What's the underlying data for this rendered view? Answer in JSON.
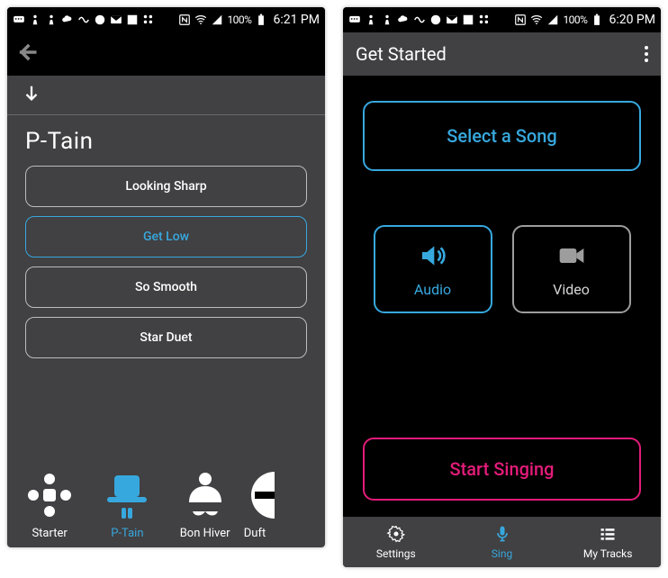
{
  "status_left": {
    "battery_text": "100%",
    "time": "6:21 PM"
  },
  "status_right": {
    "battery_text": "100%",
    "time": "6:20 PM"
  },
  "left": {
    "title": "P-Tain",
    "songs": [
      {
        "label": "Looking Sharp",
        "selected": false
      },
      {
        "label": "Get Low",
        "selected": true
      },
      {
        "label": "So Smooth",
        "selected": false
      },
      {
        "label": "Star Duet",
        "selected": false
      }
    ],
    "characters": [
      {
        "label": "Starter",
        "selected": false
      },
      {
        "label": "P-Tain",
        "selected": true
      },
      {
        "label": "Bon Hiver",
        "selected": false
      },
      {
        "label": "Duft",
        "selected": false
      }
    ]
  },
  "right": {
    "header": "Get Started",
    "select_song": "Select a Song",
    "audio": "Audio",
    "video": "Video",
    "start_singing": "Start Singing",
    "nav": {
      "settings": "Settings",
      "sing": "Sing",
      "tracks": "My Tracks"
    }
  }
}
